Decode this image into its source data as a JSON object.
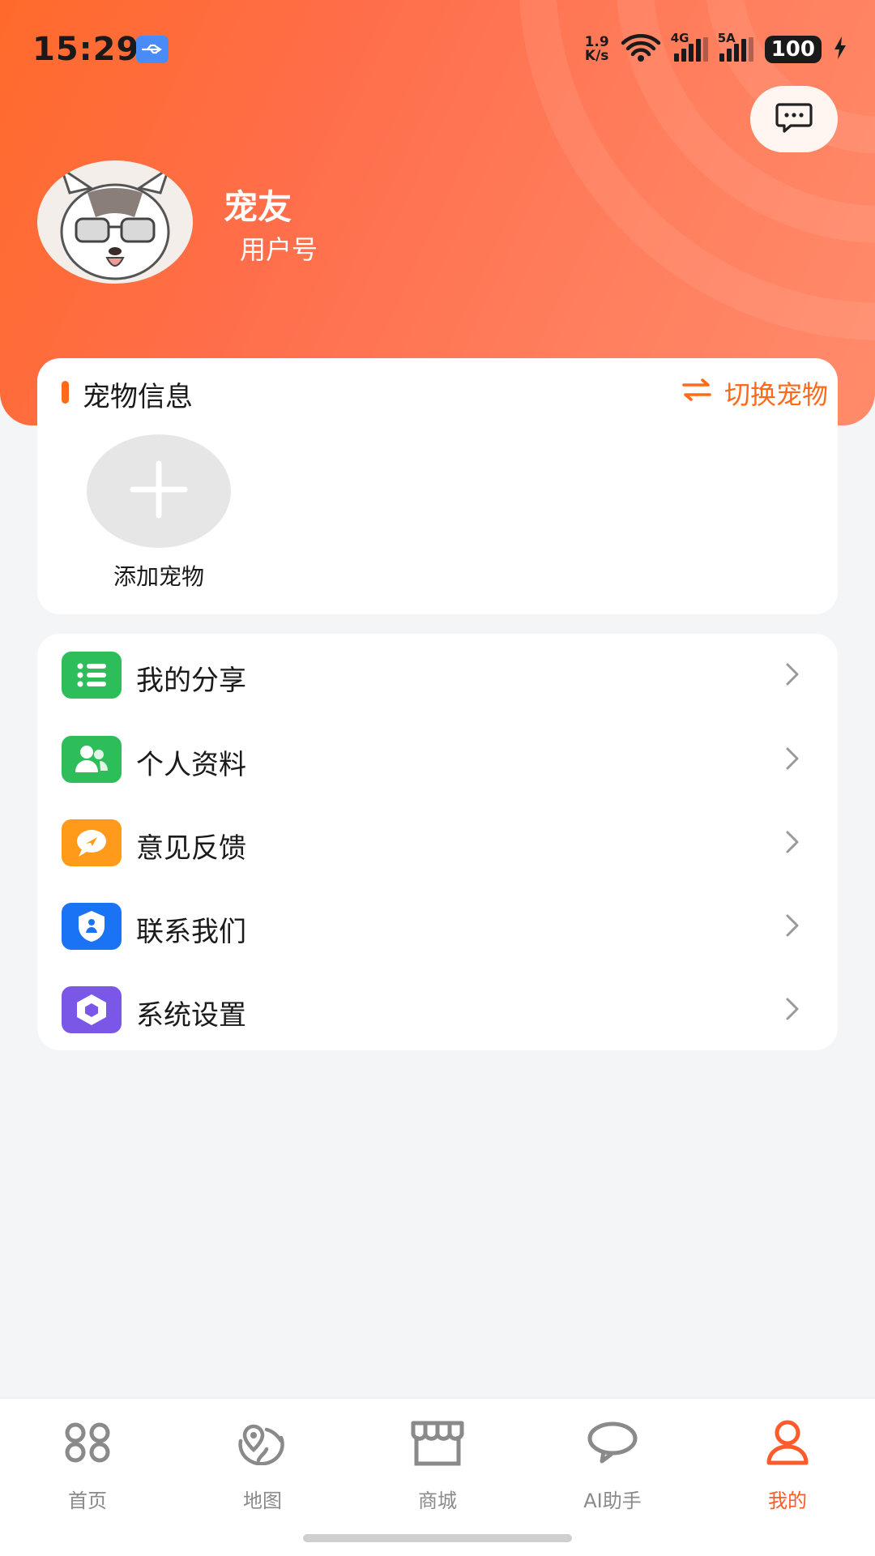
{
  "status_bar": {
    "time": "15:29",
    "net_speed_value": "1.9",
    "net_speed_unit": "K/s",
    "signal1_label": "4G",
    "signal2_label": "5A",
    "battery": "100"
  },
  "profile": {
    "username": "宠友",
    "user_id_label": "用户号"
  },
  "pet_info": {
    "title": "宠物信息",
    "switch_label": "切换宠物",
    "add_label": "添加宠物"
  },
  "menu": {
    "items": [
      {
        "label": "我的分享",
        "icon": "list-icon",
        "color": "#2dbd5a"
      },
      {
        "label": "个人资料",
        "icon": "users-icon",
        "color": "#2dbd5a"
      },
      {
        "label": "意见反馈",
        "icon": "feedback-icon",
        "color": "#ff9a1a"
      },
      {
        "label": "联系我们",
        "icon": "contact-shield-icon",
        "color": "#1a73f5"
      },
      {
        "label": "系统设置",
        "icon": "settings-hexagon-icon",
        "color": "#7b57e8"
      }
    ]
  },
  "tabs": [
    {
      "label": "首页",
      "icon": "home-grid-icon",
      "active": false
    },
    {
      "label": "地图",
      "icon": "map-icon",
      "active": false
    },
    {
      "label": "商城",
      "icon": "store-icon",
      "active": false
    },
    {
      "label": "AI助手",
      "icon": "chat-bubble-icon",
      "active": false
    },
    {
      "label": "我的",
      "icon": "profile-icon",
      "active": true
    }
  ],
  "colors": {
    "accent": "#ff6a1a",
    "active_tab": "#ff5a2a",
    "inactive_tab": "#8a8a8a"
  }
}
